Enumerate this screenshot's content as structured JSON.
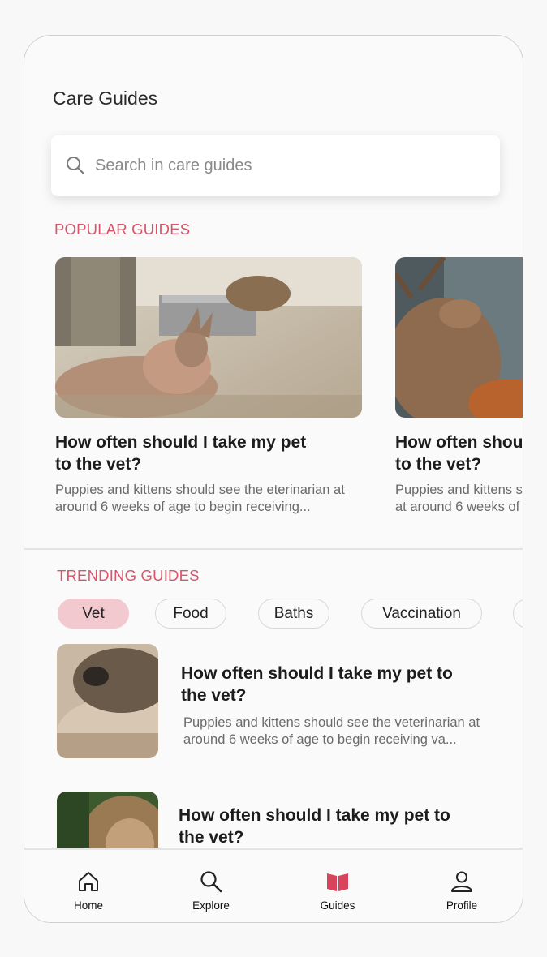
{
  "header": {
    "title": "Care Guides"
  },
  "search": {
    "placeholder": "Search in care guides",
    "value": ""
  },
  "popular": {
    "heading": "POPULAR GUIDES",
    "cards": [
      {
        "title": "How often should I take my pet to the vet?",
        "description": "Puppies and kittens should see the eterinarian at around 6 weeks of age to begin receiving..."
      },
      {
        "title": "How often shou to the vet?",
        "description": "Puppies and kittens s at around 6 weeks of"
      }
    ]
  },
  "trending": {
    "heading": "TRENDING GUIDES",
    "chips": [
      {
        "label": "Vet",
        "active": true
      },
      {
        "label": "Food",
        "active": false
      },
      {
        "label": "Baths",
        "active": false
      },
      {
        "label": "Vaccination",
        "active": false
      },
      {
        "label": "",
        "active": false
      }
    ],
    "items": [
      {
        "title": "How often should I take my pet to the vet?",
        "description": "Puppies and kittens should see the veterinarian at around 6 weeks of age to begin receiving va..."
      },
      {
        "title": "How often should I take my pet to the vet?",
        "description": ""
      }
    ]
  },
  "tabbar": {
    "active": "Guides",
    "accent": "#d9445c",
    "tabs": [
      {
        "label": "Home",
        "icon": "home-icon"
      },
      {
        "label": "Explore",
        "icon": "search-icon"
      },
      {
        "label": "Guides",
        "icon": "book-icon"
      },
      {
        "label": "Profile",
        "icon": "person-icon"
      }
    ]
  },
  "colors": {
    "accent": "#d9546a",
    "chip_active_bg": "#f3c9d0"
  }
}
